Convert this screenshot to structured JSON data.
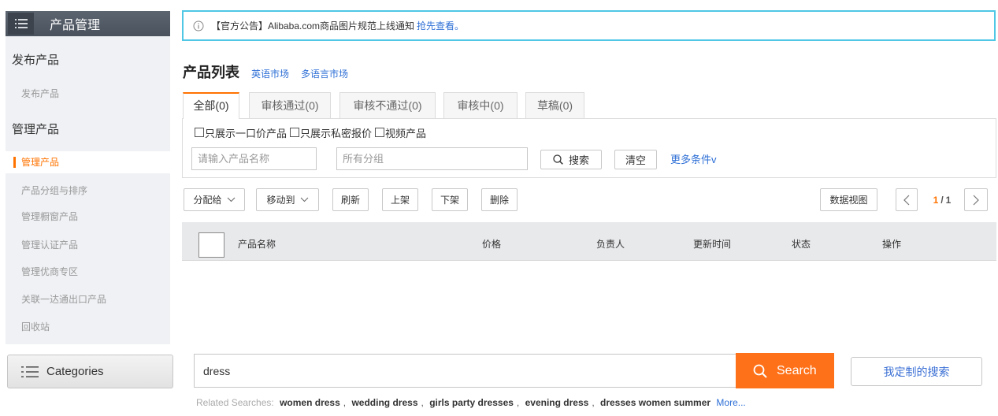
{
  "colors": {
    "sidebar_header_bg": "#4a525d",
    "sidebar_bg": "#eff1f4",
    "accent_orange": "#ff7300",
    "link_blue": "#2e6fd6",
    "notice_border": "#4fc7e5",
    "table_header_bg": "#e8e9eb",
    "search_button_bg": "#ff7119",
    "custom_search_text": "#3a6fd4"
  },
  "sidebar": {
    "menu_icon": "menu-icon",
    "title": "产品管理",
    "sections": [
      {
        "heading": "发布产品",
        "items": [
          {
            "label": "发布产品",
            "selected": false
          }
        ]
      },
      {
        "heading": "管理产品",
        "items": [
          {
            "label": "管理产品",
            "selected": true
          },
          {
            "label": "产品分组与排序",
            "selected": false
          },
          {
            "label": "管理橱窗产品",
            "selected": false
          },
          {
            "label": "管理认证产品",
            "selected": false
          },
          {
            "label": "管理优商专区",
            "selected": false
          },
          {
            "label": "关联一达通出口产品",
            "selected": false
          },
          {
            "label": "回收站",
            "selected": false
          }
        ]
      }
    ]
  },
  "notice": {
    "icon": "info-icon",
    "text": "【官方公告】Alibaba.com商品图片规范上线通知",
    "link": "抢先查看。"
  },
  "product_list": {
    "title": "产品列表",
    "market_links": [
      "英语市场",
      "多语言市场"
    ],
    "tabs": [
      {
        "label": "全部(0)",
        "active": true
      },
      {
        "label": "审核通过(0)",
        "active": false
      },
      {
        "label": "审核不通过(0)",
        "active": false
      },
      {
        "label": "审核中(0)",
        "active": false
      },
      {
        "label": "草稿(0)",
        "active": false
      }
    ],
    "filters": {
      "checkboxes": [
        {
          "label": "只展示一口价产品",
          "checked": false
        },
        {
          "label": "只展示私密报价",
          "checked": false
        },
        {
          "label": "视频产品",
          "checked": false
        }
      ],
      "name_placeholder": "请输入产品名称",
      "group_placeholder": "所有分组",
      "search_icon": "search-icon",
      "search_label": "搜索",
      "clear_label": "清空",
      "more_conditions": "更多条件v"
    },
    "toolbar": {
      "assign_label": "分配给",
      "move_label": "移动到",
      "dropdown_icon": "chevron-down-icon",
      "refresh_label": "刷新",
      "on_shelf_label": "上架",
      "off_shelf_label": "下架",
      "delete_label": "删除",
      "data_view_label": "数据视图",
      "pager": {
        "prev_icon": "chevron-left-icon",
        "current": "1",
        "separator": "/",
        "total": "1",
        "next_icon": "chevron-right-icon"
      }
    },
    "table": {
      "select_all_checked": false,
      "columns": [
        "产品名称",
        "价格",
        "负责人",
        "更新时间",
        "状态",
        "操作"
      ]
    }
  },
  "search_bar": {
    "categories_icon": "list-icon",
    "categories_label": "Categories",
    "query": "dress",
    "search_icon": "search-icon",
    "search_label": "Search",
    "custom_search_label": "我定制的搜索",
    "related_label": "Related Searches:",
    "related": [
      "women dress",
      "wedding dress",
      "girls party dresses",
      "evening dress",
      "dresses women summer"
    ],
    "related_separator": ",",
    "more": "More..."
  }
}
